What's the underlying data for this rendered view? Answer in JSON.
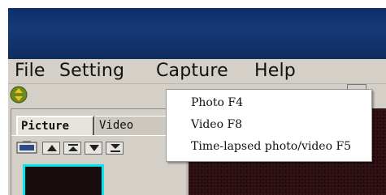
{
  "menubar": {
    "items": [
      "File",
      "Setting",
      "Capture",
      "Help"
    ]
  },
  "capture_menu": {
    "items": [
      "Photo F4",
      "Video F8",
      "Time-lapsed photo/video F5"
    ]
  },
  "panel": {
    "tabs": [
      "Picture",
      "Video"
    ]
  },
  "colors": {
    "title_bar": "#143a78",
    "chrome": "#d4d0c8",
    "thumbnail_border": "#00e8f0"
  }
}
